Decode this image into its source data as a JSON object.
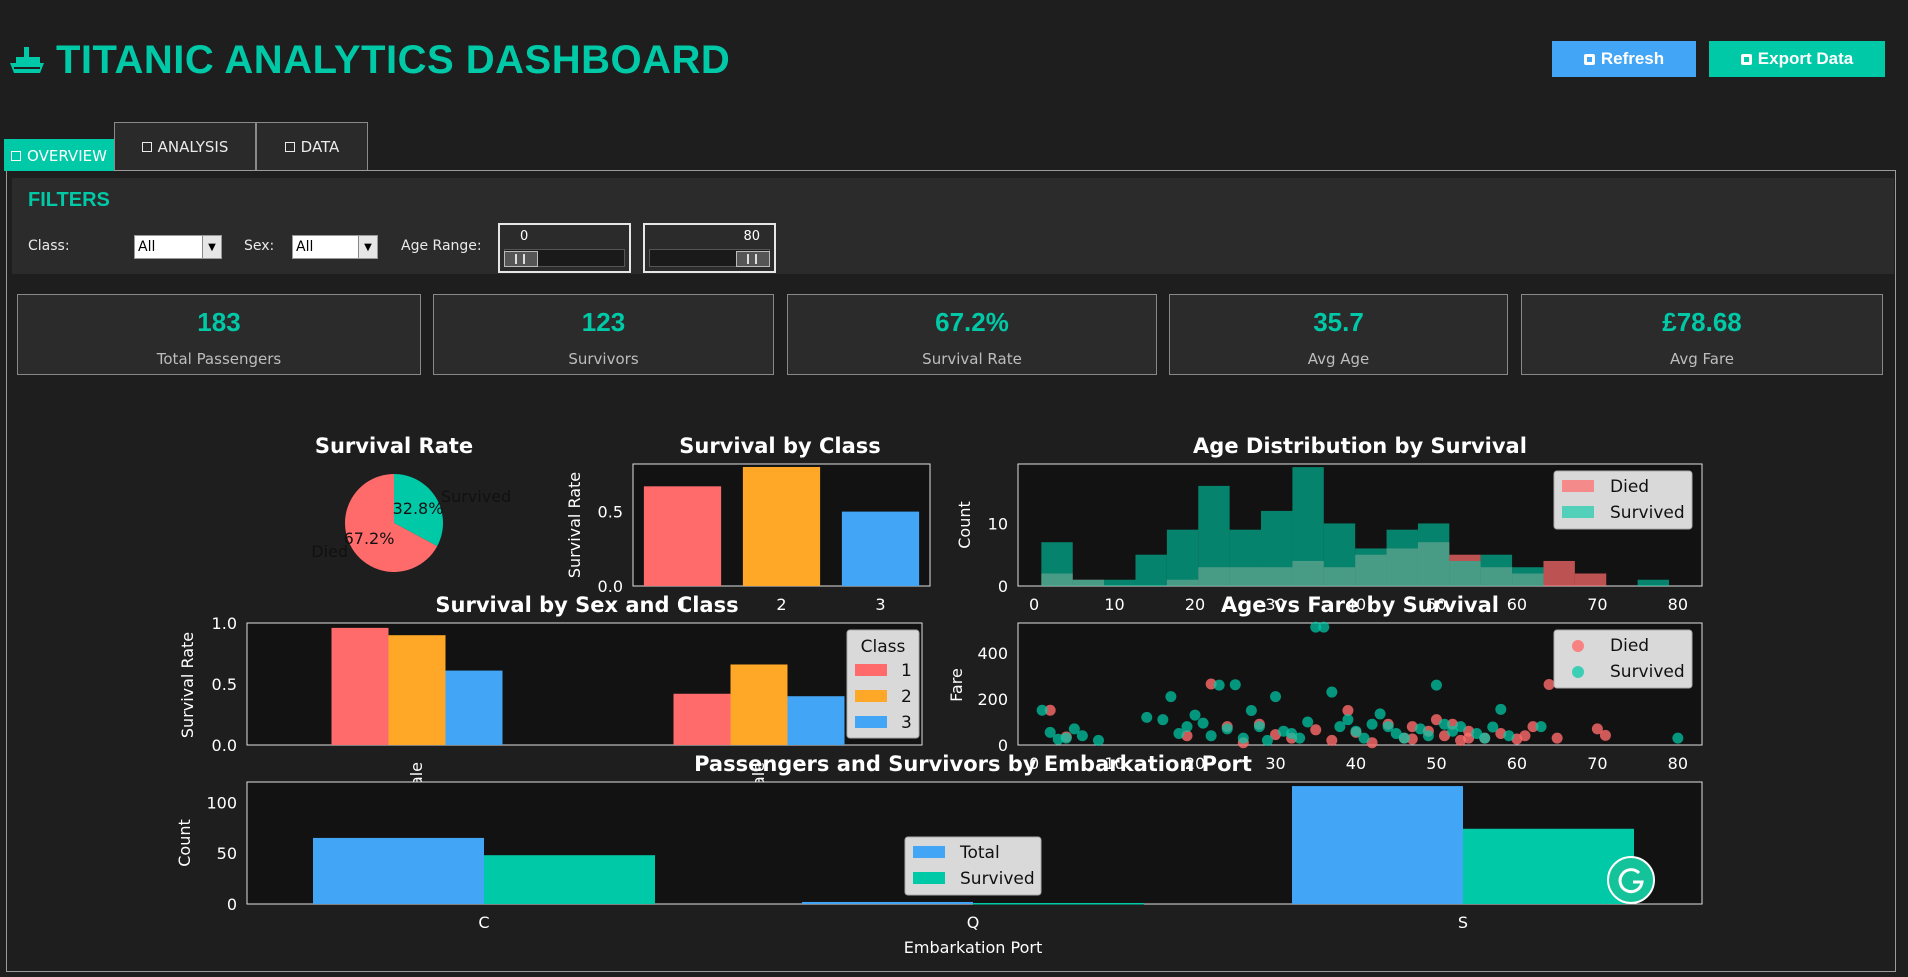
{
  "app": {
    "title": "TITANIC ANALYTICS DASHBOARD",
    "refresh_label": "Refresh",
    "export_label": "Export Data"
  },
  "tabs": [
    {
      "label": "OVERVIEW"
    },
    {
      "label": "ANALYSIS"
    },
    {
      "label": "DATA"
    }
  ],
  "filters": {
    "title": "FILTERS",
    "class_label": "Class:",
    "class_value": "All",
    "sex_label": "Sex:",
    "sex_value": "All",
    "age_label": "Age Range:",
    "age_min": "0",
    "age_max": "80",
    "age_min_fraction": 0.0,
    "age_max_fraction": 1.0
  },
  "kpis": [
    {
      "value": "183",
      "label": "Total Passengers"
    },
    {
      "value": "123",
      "label": "Survivors"
    },
    {
      "value": "67.2%",
      "label": "Survival Rate"
    },
    {
      "value": "35.7",
      "label": "Avg Age"
    },
    {
      "value": "£78.68",
      "label": "Avg Fare"
    }
  ],
  "colors": {
    "accent": "#00c9a7",
    "died": "#ff6b6b",
    "class1": "#ff6b6b",
    "class2": "#ffa726",
    "class3": "#42a5f5",
    "survived": "#00c9a7",
    "total": "#42a5f5"
  },
  "icons": {
    "title": "ship-icon",
    "refresh": "refresh-icon",
    "export": "save-icon"
  },
  "chart_data": [
    {
      "type": "pie",
      "title": "Survival Rate",
      "labels": [
        "Died",
        "Survived"
      ],
      "values": [
        67.2,
        32.8
      ],
      "pct_labels": [
        "67.2%",
        "32.8%"
      ],
      "colors": [
        "#ff6b6b",
        "#00c9a7"
      ]
    },
    {
      "type": "bar",
      "title": "Survival by Class",
      "categories": [
        "1",
        "2",
        "3"
      ],
      "values": [
        0.67,
        0.8,
        0.5
      ],
      "ylabel": "Survival Rate",
      "ylim": [
        0,
        0.82
      ],
      "yticks": [
        "0.0",
        "0.5"
      ],
      "colors": [
        "#ff6b6b",
        "#ffa726",
        "#42a5f5"
      ]
    },
    {
      "type": "bar",
      "title": "Age Distribution by Survival",
      "ylabel": "Count",
      "xlim": [
        -2,
        83
      ],
      "ylim": [
        0,
        19.5
      ],
      "xticks": [
        "0",
        "10",
        "20",
        "30",
        "40",
        "50",
        "60",
        "70",
        "80"
      ],
      "yticks": [
        "0",
        "10"
      ],
      "legend": [
        "Died",
        "Survived"
      ],
      "legend_position": "top-right",
      "series": [
        {
          "name": "Died",
          "bin_edges": [
            0.9,
            4.8,
            8.7,
            12.6,
            16.5,
            20.4,
            24.3,
            28.2,
            32.1,
            36,
            39.9,
            43.8,
            47.7,
            51.6,
            55.5,
            59.4,
            63.3,
            67.2,
            71.1,
            75,
            78.9
          ],
          "counts": [
            2,
            1,
            0,
            0,
            1,
            3,
            3,
            3,
            4,
            3,
            5,
            6,
            7,
            5,
            3,
            2,
            4,
            2,
            0,
            0
          ]
        },
        {
          "name": "Survived",
          "bin_edges": [
            0.9,
            4.8,
            8.7,
            12.6,
            16.5,
            20.4,
            24.3,
            28.2,
            32.1,
            36,
            39.9,
            43.8,
            47.7,
            51.6,
            55.5,
            59.4,
            63.3,
            67.2,
            71.1,
            75,
            78.9
          ],
          "counts": [
            7,
            1,
            1,
            5,
            9,
            16,
            9,
            12,
            19,
            10,
            6,
            9,
            10,
            4,
            5,
            3,
            0,
            0,
            0,
            1
          ]
        }
      ]
    },
    {
      "type": "bar",
      "title": "Survival by Sex and Class",
      "categories": [
        "female",
        "male"
      ],
      "ylabel": "Survival Rate",
      "ylim": [
        0,
        1.0
      ],
      "yticks": [
        "0.0",
        "0.5",
        "1.0"
      ],
      "legend_title": "Class",
      "legend_position": "top-right",
      "series": [
        {
          "name": "1",
          "values": [
            0.96,
            0.42
          ]
        },
        {
          "name": "2",
          "values": [
            0.9,
            0.66
          ]
        },
        {
          "name": "3",
          "values": [
            0.61,
            0.4
          ]
        }
      ]
    },
    {
      "type": "scatter",
      "title": "Age vs Fare by Survival",
      "ylabel": "Fare",
      "xlim": [
        -2,
        83
      ],
      "ylim": [
        0,
        530
      ],
      "xticks": [
        "0",
        "10",
        "20",
        "30",
        "40",
        "50",
        "60",
        "70",
        "80"
      ],
      "yticks": [
        "0",
        "200",
        "400"
      ],
      "legend_position": "top-right",
      "series": [
        {
          "name": "Died",
          "points": [
            [
              2,
              151
            ],
            [
              4,
              35
            ],
            [
              19,
              40
            ],
            [
              22,
              265
            ],
            [
              24,
              80
            ],
            [
              26,
              10
            ],
            [
              28,
              90
            ],
            [
              30,
              45
            ],
            [
              32,
              30
            ],
            [
              35,
              66
            ],
            [
              37,
              20
            ],
            [
              39,
              150
            ],
            [
              40,
              55
            ],
            [
              42,
              10
            ],
            [
              44,
              90
            ],
            [
              46,
              30
            ],
            [
              47,
              80
            ],
            [
              49,
              60
            ],
            [
              50,
              110
            ],
            [
              51,
              40
            ],
            [
              52,
              90
            ],
            [
              53,
              20
            ],
            [
              54,
              60
            ],
            [
              56,
              30
            ],
            [
              58,
              50
            ],
            [
              60,
              26
            ],
            [
              61,
              40
            ],
            [
              62,
              80
            ],
            [
              64,
              263
            ],
            [
              65,
              30
            ],
            [
              70,
              70
            ],
            [
              71,
              42
            ],
            [
              47,
              26
            ],
            [
              54,
              30
            ]
          ]
        },
        {
          "name": "Survived",
          "points": [
            [
              1,
              151
            ],
            [
              2,
              55
            ],
            [
              3,
              25
            ],
            [
              4,
              30
            ],
            [
              5,
              70
            ],
            [
              6,
              40
            ],
            [
              8,
              20
            ],
            [
              14,
              120
            ],
            [
              16,
              110
            ],
            [
              17,
              210
            ],
            [
              18,
              50
            ],
            [
              19,
              80
            ],
            [
              20,
              130
            ],
            [
              21,
              95
            ],
            [
              22,
              40
            ],
            [
              23,
              260
            ],
            [
              24,
              70
            ],
            [
              25,
              262
            ],
            [
              26,
              30
            ],
            [
              27,
              150
            ],
            [
              28,
              80
            ],
            [
              29,
              20
            ],
            [
              30,
              210
            ],
            [
              31,
              60
            ],
            [
              32,
              50
            ],
            [
              33,
              30
            ],
            [
              34,
              100
            ],
            [
              35,
              512
            ],
            [
              36,
              512
            ],
            [
              37,
              230
            ],
            [
              38,
              80
            ],
            [
              39,
              110
            ],
            [
              40,
              60
            ],
            [
              41,
              30
            ],
            [
              42,
              90
            ],
            [
              43,
              135
            ],
            [
              44,
              80
            ],
            [
              45,
              50
            ],
            [
              46,
              30
            ],
            [
              48,
              70
            ],
            [
              49,
              40
            ],
            [
              50,
              260
            ],
            [
              51,
              90
            ],
            [
              52,
              60
            ],
            [
              53,
              80
            ],
            [
              55,
              50
            ],
            [
              56,
              30
            ],
            [
              57,
              78
            ],
            [
              58,
              155
            ],
            [
              59,
              40
            ],
            [
              63,
              80
            ],
            [
              80,
              30
            ]
          ]
        }
      ]
    },
    {
      "type": "bar",
      "title": "Passengers and Survivors by Embarkation Port",
      "categories": [
        "C",
        "Q",
        "S"
      ],
      "xlabel": "Embarkation Port",
      "ylabel": "Count",
      "ylim": [
        0,
        120
      ],
      "yticks": [
        "0",
        "50",
        "100"
      ],
      "legend_position": "center",
      "series": [
        {
          "name": "Total",
          "values": [
            65,
            2,
            116
          ]
        },
        {
          "name": "Survived",
          "values": [
            48,
            1,
            74
          ]
        }
      ]
    }
  ]
}
